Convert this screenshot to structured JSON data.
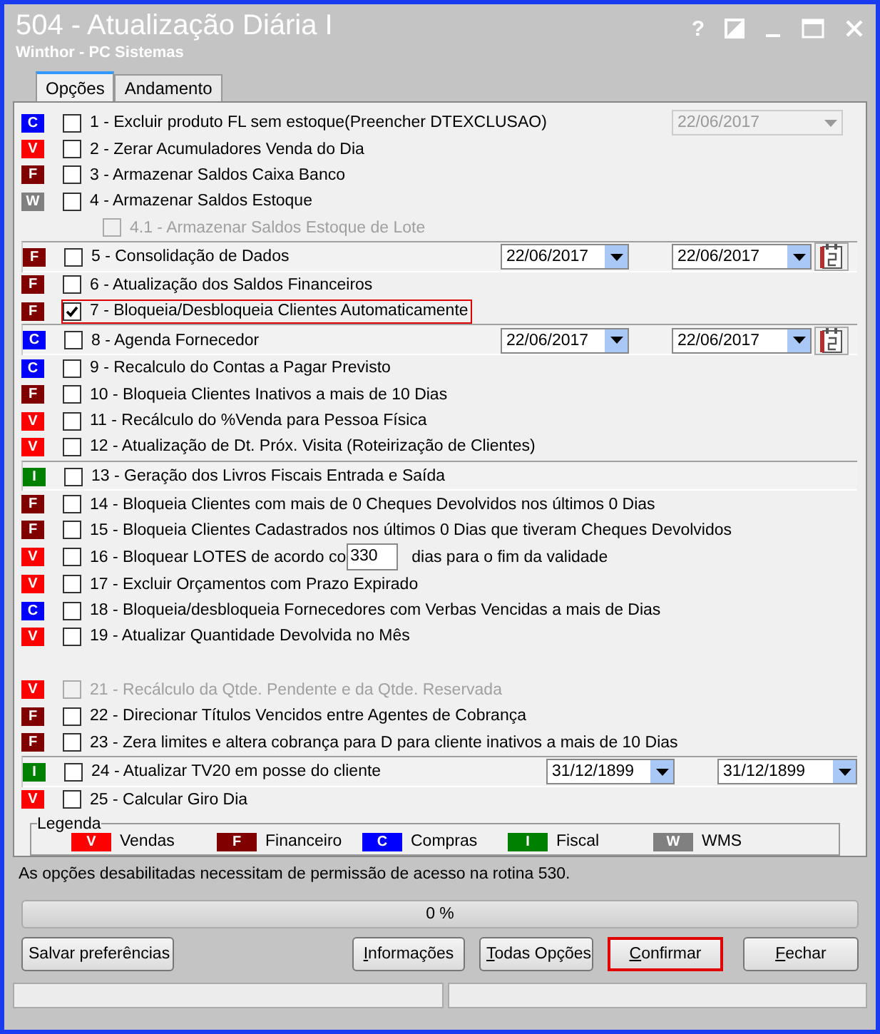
{
  "window": {
    "title": "504 - Atualização Diária I",
    "subtitle": "Winthor - PC Sistemas",
    "help": "?"
  },
  "tabs": [
    {
      "label": "Opções",
      "selected": true
    },
    {
      "label": "Andamento",
      "selected": false
    }
  ],
  "options": [
    {
      "kind": "plain",
      "badge": "C",
      "color": "#0000ff",
      "label": "1 - Excluir produto FL sem estoque(Preencher DTEXCLUSAO)",
      "checked": false,
      "disabled": false,
      "dates": [
        {
          "value": "22/06/2017",
          "disabled": true
        }
      ]
    },
    {
      "kind": "plain",
      "badge": "V",
      "color": "#ff0000",
      "label": "2 - Zerar Acumuladores Venda do Dia",
      "checked": false,
      "disabled": false
    },
    {
      "kind": "plain",
      "badge": "F",
      "color": "#800000",
      "label": "3 - Armazenar Saldos Caixa Banco",
      "checked": false,
      "disabled": false
    },
    {
      "kind": "plain",
      "badge": "W",
      "color": "#808080",
      "label": "4 - Armazenar Saldos Estoque",
      "checked": false,
      "disabled": false
    },
    {
      "kind": "sub",
      "label": "4.1 - Armazenar Saldos Estoque de Lote",
      "checked": false,
      "disabled": true
    },
    {
      "kind": "framed",
      "badge": "F",
      "color": "#800000",
      "label": "5 - Consolidação de Dados",
      "checked": false,
      "disabled": false,
      "dates": [
        {
          "value": "22/06/2017",
          "disabled": false
        },
        {
          "value": "22/06/2017",
          "disabled": false
        }
      ],
      "calendar": true
    },
    {
      "kind": "plain",
      "badge": "F",
      "color": "#800000",
      "label": "6 - Atualização dos Saldos Financeiros",
      "checked": false,
      "disabled": false
    },
    {
      "kind": "plain",
      "badge": "F",
      "color": "#800000",
      "label": "7 - Bloqueia/Desbloqueia Clientes Automaticamente",
      "checked": true,
      "disabled": false,
      "highlighted": true
    },
    {
      "kind": "framed",
      "badge": "C",
      "color": "#0000ff",
      "label": "8 - Agenda Fornecedor",
      "checked": false,
      "disabled": false,
      "dates": [
        {
          "value": "22/06/2017",
          "disabled": false
        },
        {
          "value": "22/06/2017",
          "disabled": false
        }
      ],
      "calendar": true
    },
    {
      "kind": "plain",
      "badge": "C",
      "color": "#0000ff",
      "label": "9 - Recalculo do Contas a Pagar Previsto",
      "checked": false,
      "disabled": false
    },
    {
      "kind": "plain",
      "badge": "F",
      "color": "#800000",
      "label": "10 - Bloqueia Clientes Inativos a mais de 10 Dias",
      "checked": false,
      "disabled": false
    },
    {
      "kind": "plain",
      "badge": "V",
      "color": "#ff0000",
      "label": "11 - Recálculo do %Venda para Pessoa Física",
      "checked": false,
      "disabled": false
    },
    {
      "kind": "plain",
      "badge": "V",
      "color": "#ff0000",
      "label": "12 - Atualização de Dt. Próx. Visita (Roteirização de Clientes)",
      "checked": false,
      "disabled": false
    },
    {
      "kind": "framed",
      "badge": "I",
      "color": "#008000",
      "label": "13 - Geração dos Livros Fiscais Entrada e Saída",
      "checked": false,
      "disabled": false
    },
    {
      "kind": "plain",
      "badge": "F",
      "color": "#800000",
      "label": "14 - Bloqueia Clientes com mais de 0 Cheques Devolvidos nos últimos 0  Dias",
      "checked": false,
      "disabled": false
    },
    {
      "kind": "plain",
      "badge": "F",
      "color": "#800000",
      "label": "15 - Bloqueia Clientes Cadastrados nos últimos 0 Dias que tiveram Cheques Devolvidos",
      "checked": false,
      "disabled": false
    },
    {
      "kind": "input",
      "badge": "V",
      "color": "#ff0000",
      "label": "16 - Bloquear LOTES de acordo co",
      "value": "330",
      "suffix": "dias para o fim da validade",
      "checked": false,
      "disabled": false
    },
    {
      "kind": "plain",
      "badge": "V",
      "color": "#ff0000",
      "label": "17 - Excluir Orçamentos com Prazo Expirado",
      "checked": false,
      "disabled": false
    },
    {
      "kind": "plain",
      "badge": "C",
      "color": "#0000ff",
      "label": "18 - Bloqueia/desbloqueia Fornecedores com Verbas Vencidas a mais de  Dias",
      "checked": false,
      "disabled": false
    },
    {
      "kind": "plain",
      "badge": "V",
      "color": "#ff0000",
      "label": "19 - Atualizar Quantidade Devolvida no Mês",
      "checked": false,
      "disabled": false
    },
    {
      "kind": "plain",
      "badge": "V",
      "color": "#ff0000",
      "label": "21 - Recálculo da Qtde. Pendente e da Qtde. Reservada",
      "checked": false,
      "disabled": true,
      "gap_before": true
    },
    {
      "kind": "plain",
      "badge": "F",
      "color": "#800000",
      "label": "22 - Direcionar Títulos Vencidos entre Agentes de Cobrança",
      "checked": false,
      "disabled": false
    },
    {
      "kind": "plain",
      "badge": "F",
      "color": "#800000",
      "label": "23 - Zera limites e altera cobrança para D  para cliente inativos a mais de 10 Dias",
      "checked": false,
      "disabled": false
    },
    {
      "kind": "framed",
      "badge": "I",
      "color": "#008000",
      "label": "24 - Atualizar TV20 em posse do cliente",
      "checked": false,
      "disabled": false,
      "dates": [
        {
          "value": "31/12/1899",
          "disabled": false
        },
        {
          "value": "31/12/1899",
          "disabled": false
        }
      ]
    },
    {
      "kind": "plain",
      "badge": "V",
      "color": "#ff0000",
      "label": "25 - Calcular Giro Dia",
      "checked": false,
      "disabled": false
    }
  ],
  "legend": {
    "title": "Legenda",
    "items": [
      {
        "badge": "V",
        "color": "#ff0000",
        "label": "Vendas"
      },
      {
        "badge": "F",
        "color": "#800000",
        "label": "Financeiro"
      },
      {
        "badge": "C",
        "color": "#0000ff",
        "label": "Compras"
      },
      {
        "badge": "I",
        "color": "#008000",
        "label": "Fiscal"
      },
      {
        "badge": "W",
        "color": "#808080",
        "label": "WMS"
      }
    ]
  },
  "note": "As opções desabilitadas necessitam de permissão de acesso na rotina 530.",
  "progress": {
    "text": "0 %",
    "level": 0
  },
  "buttons": [
    {
      "label": "Salvar preferências",
      "highlighted": false
    },
    {
      "label": "Informações",
      "underline_first": true,
      "highlighted": false
    },
    {
      "label": "Todas Opções",
      "underline_first": true,
      "highlighted": false
    },
    {
      "label": "Confirmar",
      "underline_first": true,
      "highlighted": true
    },
    {
      "label": "Fechar",
      "underline_first": true,
      "highlighted": false
    }
  ]
}
